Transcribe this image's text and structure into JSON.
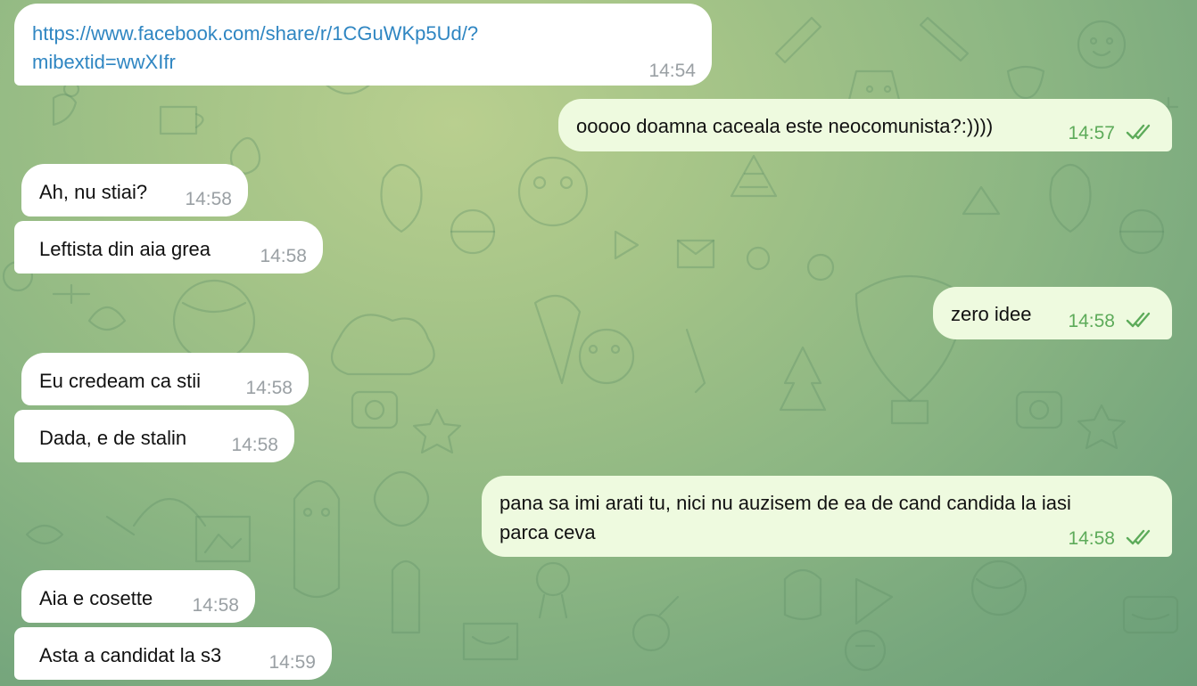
{
  "chat": {
    "messages": [
      {
        "id": "m1",
        "side": "in",
        "lines": [
          "https://www.facebook.com/share/r/1CGuWKp5Ud/?",
          "mibextid=wwXIfr"
        ],
        "time": "14:54",
        "is_link": true
      },
      {
        "id": "m2",
        "side": "out",
        "lines": [
          "ooooo doamna caceala este neocomunista?:))))"
        ],
        "time": "14:57",
        "status": "read"
      },
      {
        "id": "m3",
        "side": "in",
        "lines": [
          "Ah, nu stiai?"
        ],
        "time": "14:58"
      },
      {
        "id": "m4",
        "side": "in",
        "lines": [
          "Leftista din aia grea"
        ],
        "time": "14:58"
      },
      {
        "id": "m5",
        "side": "out",
        "lines": [
          "zero idee"
        ],
        "time": "14:58",
        "status": "read"
      },
      {
        "id": "m6",
        "side": "in",
        "lines": [
          "Eu credeam ca stii"
        ],
        "time": "14:58"
      },
      {
        "id": "m7",
        "side": "in",
        "lines": [
          "Dada, e de stalin"
        ],
        "time": "14:58"
      },
      {
        "id": "m8",
        "side": "out",
        "lines": [
          "pana sa imi arati tu, nici nu auzisem de ea de cand candida la iasi",
          "parca ceva"
        ],
        "time": "14:58",
        "status": "read"
      },
      {
        "id": "m9",
        "side": "in",
        "lines": [
          "Aia e cosette"
        ],
        "time": "14:58"
      },
      {
        "id": "m10",
        "side": "in",
        "lines": [
          "Asta a candidat la s3"
        ],
        "time": "14:59"
      }
    ]
  },
  "icons": {
    "read_receipt": "double-check-icon",
    "background": "doodle-pattern"
  },
  "colors": {
    "incoming_bubble": "#ffffff",
    "outgoing_bubble": "#eefadf",
    "outgoing_meta": "#5dab5a",
    "incoming_meta": "#9aa0a4",
    "link": "#2f86c2"
  }
}
